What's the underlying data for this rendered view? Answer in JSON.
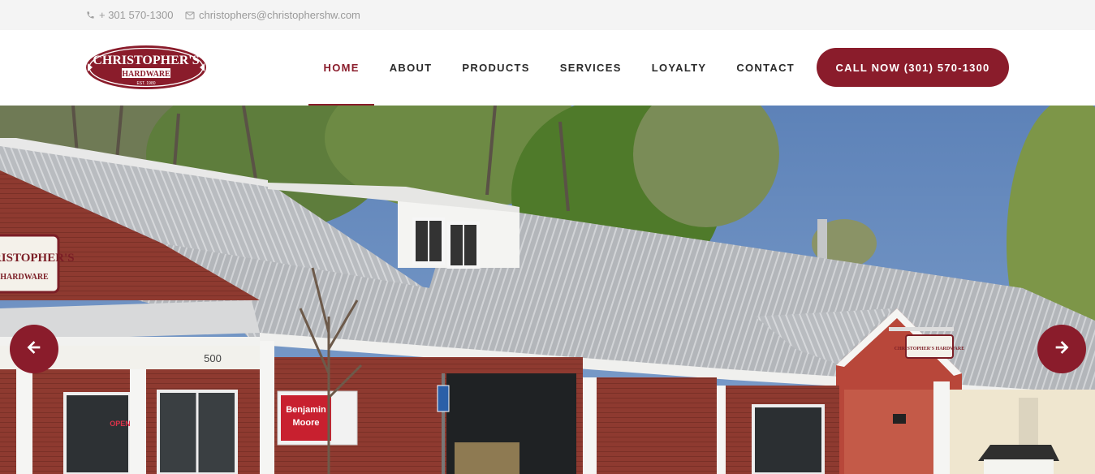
{
  "topbar": {
    "phone": "+ 301 570-1300",
    "phone_icon": "phone-icon",
    "email": "christophers@christophershw.com",
    "email_icon": "mail-icon"
  },
  "logo": {
    "name": "CHRISTOPHER'S",
    "sub": "HARDWARE",
    "est": "EST. 1980"
  },
  "nav": {
    "items": [
      {
        "label": "HOME",
        "active": true
      },
      {
        "label": "ABOUT",
        "active": false
      },
      {
        "label": "PRODUCTS",
        "active": false
      },
      {
        "label": "SERVICES",
        "active": false
      },
      {
        "label": "LOYALTY",
        "active": false
      },
      {
        "label": "CONTACT",
        "active": false
      }
    ]
  },
  "cta": {
    "label": "CALL NOW (301) 570-1300"
  },
  "hero": {
    "address_number": "500",
    "store_sign_line1": "CHRISTOPHER'S",
    "store_sign_line2": "HARDWARE",
    "small_sign": "CHRISTOPHER'S HARDWARE",
    "paint_sign_line1": "Benjamin",
    "paint_sign_line2": "Moore",
    "open_sign": "OPEN",
    "prev_icon": "arrow-left-icon",
    "next_icon": "arrow-right-icon"
  },
  "colors": {
    "brand": "#8a1c2b",
    "topbar_bg": "#f4f4f4",
    "topbar_text": "#9a9a9a",
    "nav_text": "#2a2a2a"
  }
}
